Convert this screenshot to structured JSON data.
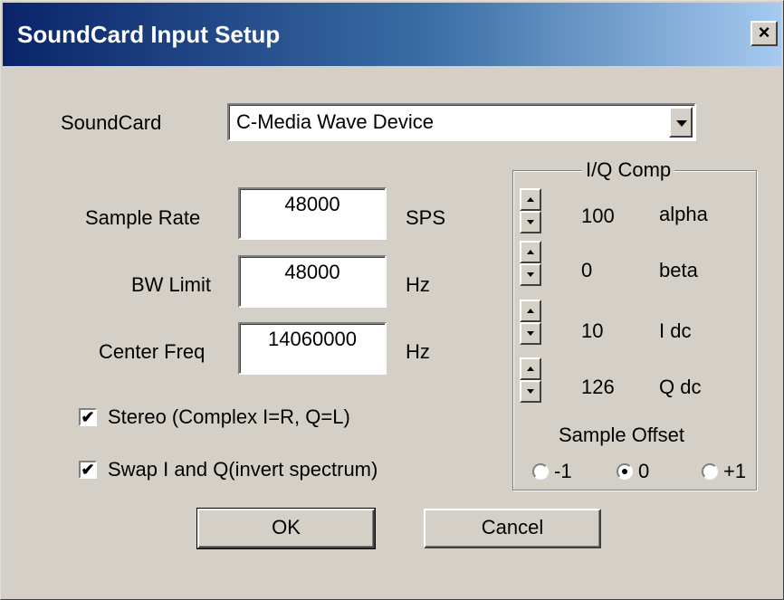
{
  "window": {
    "title": "SoundCard Input Setup",
    "close_glyph": "×"
  },
  "soundcard": {
    "label": "SoundCard",
    "selected": "C-Media Wave Device"
  },
  "sample_rate": {
    "label": "Sample Rate",
    "value": "48000",
    "unit": "SPS"
  },
  "bw_limit": {
    "label": "BW Limit",
    "value": "48000",
    "unit": "Hz"
  },
  "center_freq": {
    "label": "Center Freq",
    "value": "14060000",
    "unit": "Hz"
  },
  "options": [
    {
      "label": "Stereo (Complex I=R, Q=L)",
      "checked": true,
      "mark": "✔"
    },
    {
      "label": "Swap I and Q(invert spectrum)",
      "checked": true,
      "mark": "✔"
    }
  ],
  "iq_comp": {
    "title": "I/Q Comp",
    "rows": [
      {
        "value": "100",
        "label": "alpha"
      },
      {
        "value": "0",
        "label": "beta"
      },
      {
        "value": "10",
        "label": "I dc"
      },
      {
        "value": "126",
        "label": "Q dc"
      }
    ],
    "sample_offset": {
      "label": "Sample Offset",
      "options": [
        {
          "label": "-1",
          "selected": false
        },
        {
          "label": "0",
          "selected": true
        },
        {
          "label": "+1",
          "selected": false
        }
      ]
    }
  },
  "buttons": {
    "ok": "OK",
    "cancel": "Cancel"
  },
  "colors": {
    "face": "#d4d0c8",
    "title_start": "#0a246a",
    "title_end": "#a6caf0"
  }
}
